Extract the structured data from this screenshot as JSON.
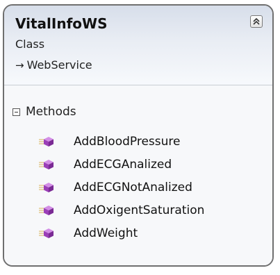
{
  "class": {
    "name": "VitalInfoWS",
    "stereotype": "Class",
    "base": "WebService"
  },
  "compartment": {
    "label": "Methods",
    "items": [
      {
        "label": "AddBloodPressure"
      },
      {
        "label": "AddECGAnalized"
      },
      {
        "label": "AddECGNotAnalized"
      },
      {
        "label": "AddOxigentSaturation"
      },
      {
        "label": "AddWeight"
      }
    ]
  },
  "colors": {
    "border": "#6f6f6f",
    "header_gradient_top": "#d7deea",
    "method_icon": "#9b3fb8"
  },
  "icons": {
    "collapse": "double-chevron-up-icon",
    "inheritance": "right-arrow-icon",
    "section_toggle": "minus-box-icon",
    "method": "method-cube-icon"
  }
}
